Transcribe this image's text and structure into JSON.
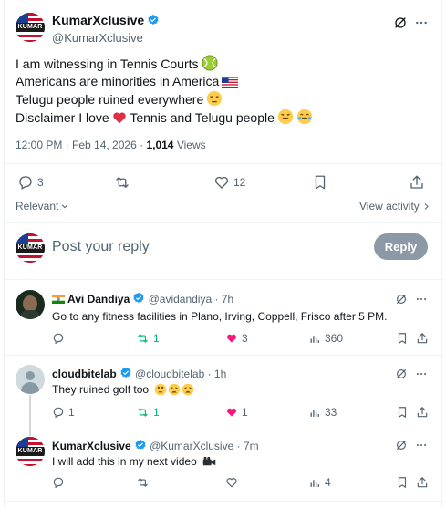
{
  "main_tweet": {
    "author_name": "KumarXclusive",
    "author_handle": "@KumarXclusive",
    "avatar_text": "KUMAR",
    "lines": [
      "I am witnessing in Tennis Courts",
      "Americans are minorities in America",
      "Telugu people ruined everywhere",
      "Disclaimer I love",
      "Tennis and Telugu people"
    ],
    "time": "12:00 PM · Feb 14, 2026 ·",
    "views_count": "1,014",
    "views_label": "Views",
    "replies": "3",
    "likes": "12"
  },
  "sort": {
    "label": "Relevant",
    "view_activity": "View activity"
  },
  "composer": {
    "placeholder": "Post your reply",
    "button": "Reply"
  },
  "replies": [
    {
      "name": "Avi Dandiya",
      "handle": "@avidandiya",
      "time": "· 7h",
      "text": "Go to any fitness facilities in Plano, Irving, Coppell, Frisco after 5 PM.",
      "reposts": "1",
      "likes": "3",
      "views": "360"
    },
    {
      "name": "cloudbitelab",
      "handle": "@cloudbitelab",
      "time": "· 1h",
      "text": "They ruined golf too",
      "replies": "1",
      "reposts": "1",
      "likes": "1",
      "views": "33"
    },
    {
      "name": "KumarXclusive",
      "handle": "@KumarXclusive",
      "time": "· 7m",
      "text": "I will add this in my next video",
      "views": "4"
    }
  ],
  "colors": {
    "accent": "#1d9bf0",
    "like": "#f91880",
    "repost": "#00ba7c",
    "muted": "#536471"
  }
}
